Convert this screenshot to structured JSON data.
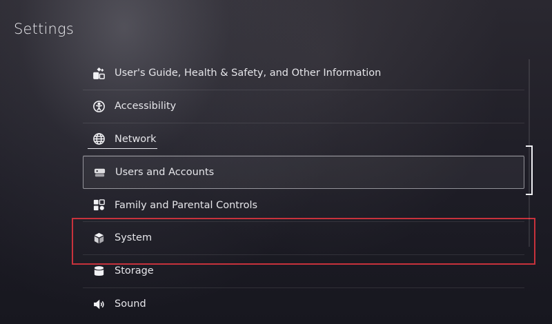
{
  "header": {
    "title": "Settings"
  },
  "menu": {
    "items": [
      {
        "label": "User's Guide, Health & Safety, and Other Information",
        "icon": "guide-icon"
      },
      {
        "label": "Accessibility",
        "icon": "accessibility-icon"
      },
      {
        "label": "Network",
        "icon": "globe-icon"
      },
      {
        "label": "Users and Accounts",
        "icon": "users-icon"
      },
      {
        "label": "Family and Parental Controls",
        "icon": "family-icon"
      },
      {
        "label": "System",
        "icon": "cube-icon"
      },
      {
        "label": "Storage",
        "icon": "database-icon"
      },
      {
        "label": "Sound",
        "icon": "speaker-icon"
      }
    ],
    "focused_index": 3,
    "annotated_index": 5
  },
  "colors": {
    "annotation": "#c8323c",
    "text": "#e6e6ea",
    "background": "#1e1d26"
  }
}
